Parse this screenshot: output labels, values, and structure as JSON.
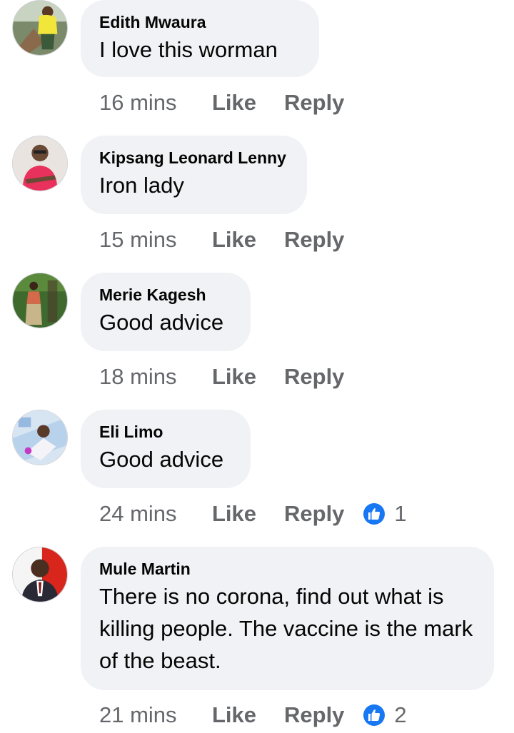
{
  "colors": {
    "bubble_bg": "#f0f2f5",
    "text_primary": "#050505",
    "text_secondary": "#65676b",
    "like_blue": "#1877f2"
  },
  "comments": [
    {
      "author": "Edith Mwaura",
      "text": "I love this worman",
      "time": "16 mins",
      "like_label": "Like",
      "reply_label": "Reply"
    },
    {
      "author": "Kipsang Leonard Lenny",
      "text": "Iron lady",
      "time": "15 mins",
      "like_label": "Like",
      "reply_label": "Reply"
    },
    {
      "author": "Merie Kagesh",
      "text": "Good advice",
      "time": "18 mins",
      "like_label": "Like",
      "reply_label": "Reply"
    },
    {
      "author": "Eli Limo",
      "text": "Good advice",
      "time": "24 mins",
      "like_label": "Like",
      "reply_label": "Reply",
      "reaction_icon": "like-icon",
      "reaction_count": "1"
    },
    {
      "author": "Mule Martin",
      "text": "There is no corona, find out what is killing people. The vaccine is the mark of the beast.",
      "time": "21 mins",
      "like_label": "Like",
      "reply_label": "Reply",
      "reaction_icon": "like-icon",
      "reaction_count": "2"
    }
  ]
}
